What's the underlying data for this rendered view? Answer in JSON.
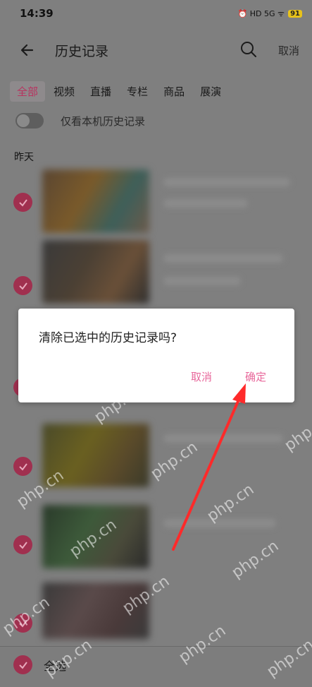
{
  "status": {
    "time": "14:39",
    "icons": "⏰ HD 5G ᯤ",
    "battery": "91"
  },
  "header": {
    "title": "历史记录",
    "cancel": "取消"
  },
  "tabs": [
    {
      "label": "全部"
    },
    {
      "label": "视频"
    },
    {
      "label": "直播"
    },
    {
      "label": "专栏"
    },
    {
      "label": "商品"
    },
    {
      "label": "展演"
    }
  ],
  "toggle": {
    "label": "仅看本机历史记录"
  },
  "sections": {
    "yesterday": "昨天"
  },
  "bottom": {
    "select_all": "全选"
  },
  "dialog": {
    "message": "清除已选中的历史记录吗?",
    "cancel": "取消",
    "confirm": "确定"
  },
  "watermark": {
    "text": "php.cn"
  },
  "colors": {
    "accent": "#e8689b",
    "check": "#a0304f",
    "arrow": "#ff2a2a"
  }
}
